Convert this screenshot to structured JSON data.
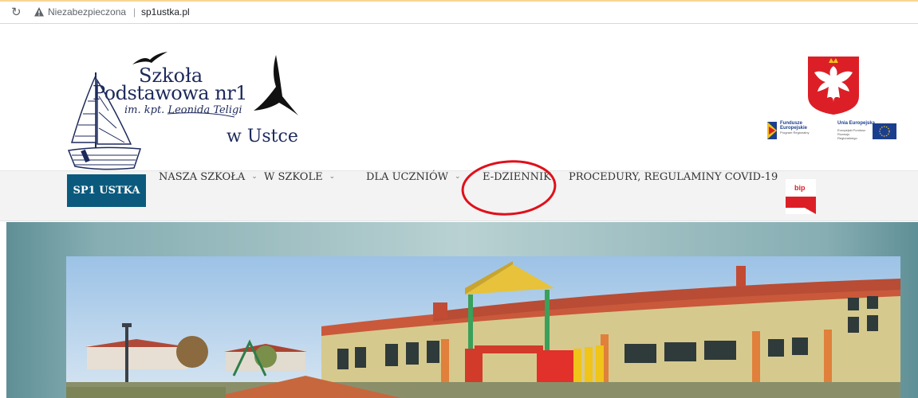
{
  "browser": {
    "reload_icon": "reload-icon",
    "warning_icon": "warning-icon",
    "security_label": "Niezabezpieczona",
    "separator": "|",
    "url": "sp1ustka.pl"
  },
  "header": {
    "logo": {
      "line1": "Szkoła",
      "line2": "Podstawowa nr1",
      "line3": "im. kpt. Leonida Teligi",
      "line4": "w Ustce"
    },
    "eu": {
      "fundusze": "Fundusze Europejskie",
      "program": "Program Regionalny",
      "unia": "Unia Europejska",
      "fundusz": "Europejski Fundusz Rozwoju Regionalnego"
    }
  },
  "nav": {
    "items": [
      {
        "label": "SP1 USTKA",
        "active": true
      },
      {
        "label": "NASZA SZKOŁA",
        "chevron": "⌄"
      },
      {
        "label": "W SZKOLE",
        "chevron": "⌄"
      },
      {
        "label": "DLA UCZNIÓW",
        "chevron": "⌄"
      },
      {
        "label": "E-DZIENNIK"
      },
      {
        "label": "PROCEDURY, REGULAMINY COVID-19"
      }
    ],
    "bip_label": "bip"
  },
  "colors": {
    "nav_active": "#0b5a7e",
    "annotation": "#e0101a",
    "logo_text": "#1d2a5c",
    "eu_blue": "#1b3f8f"
  }
}
